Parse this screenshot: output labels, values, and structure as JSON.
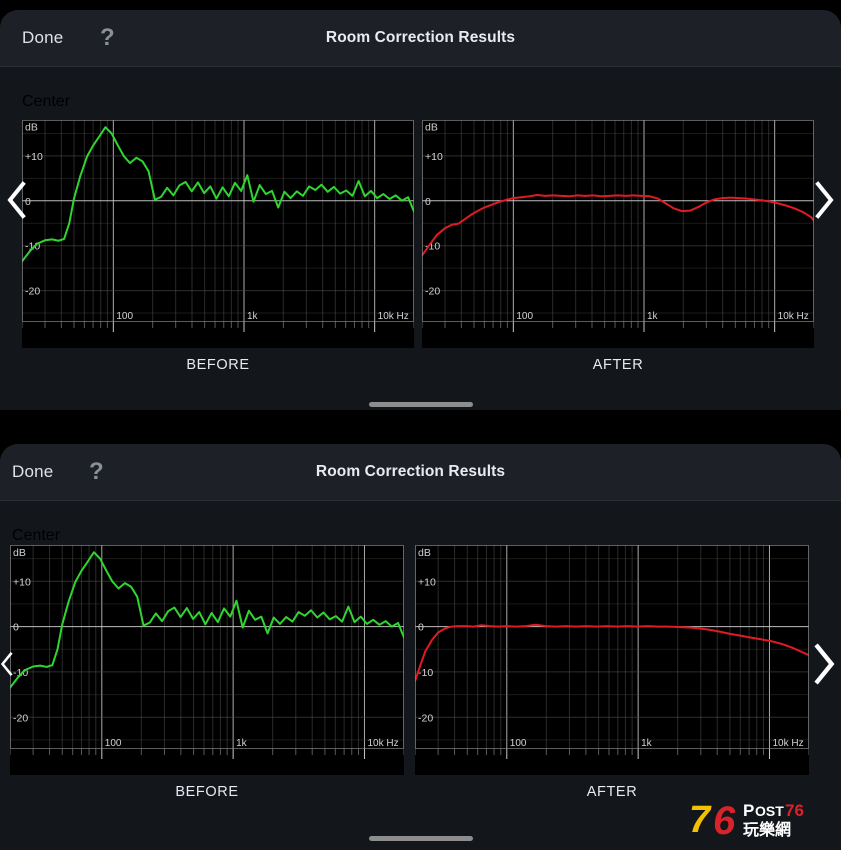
{
  "panels": [
    {
      "navbar": {
        "done_label": "Done",
        "help_icon": "question-mark-icon",
        "title": "Room Correction Results"
      },
      "channel": "Center",
      "before_caption": "BEFORE",
      "after_caption": "AFTER"
    },
    {
      "navbar": {
        "done_label": "Done",
        "help_icon": "question-mark-icon",
        "title": "Room Correction Results"
      },
      "channel": "Center",
      "before_caption": "BEFORE",
      "after_caption": "AFTER"
    }
  ],
  "nav": {
    "prev_icon": "chevron-left-icon",
    "next_icon": "chevron-right-icon"
  },
  "axis": {
    "y_unit": "dB",
    "y_ticks": [
      "+10",
      "0",
      "-10",
      "-20"
    ],
    "x_ticks": [
      "100",
      "1k",
      "10k Hz"
    ]
  },
  "colors": {
    "before_curve": "#2fd62f",
    "after_curve": "#e01b24",
    "plot_background": "#000000",
    "grid": "#4a4a4a",
    "zero_line": "#c8c8c8",
    "panel_background": "#13161b",
    "navbar_background": "#1d2026",
    "text": "#e9ecef"
  },
  "watermark": {
    "number": "76",
    "brand": "Post76",
    "chinese": "玩樂網"
  },
  "chart_data": [
    {
      "type": "line",
      "title": "Center BEFORE",
      "xlabel": "Hz",
      "ylabel": "dB",
      "xscale": "log",
      "xlim": [
        20,
        20000
      ],
      "ylim": [
        -27,
        18
      ],
      "grid": true,
      "series": [
        {
          "name": "BEFORE",
          "color": "#2fd62f",
          "x": [
            20,
            23,
            26,
            30,
            34,
            38,
            42,
            46,
            50,
            56,
            63,
            70,
            78,
            87,
            97,
            108,
            120,
            134,
            150,
            167,
            186,
            208,
            232,
            258,
            288,
            320,
            357,
            398,
            444,
            495,
            552,
            615,
            686,
            765,
            853,
            951,
            1060,
            1182,
            1318,
            1470,
            1639,
            1828,
            2038,
            2273,
            2535,
            2827,
            3152,
            3515,
            3920,
            4371,
            4874,
            5435,
            6061,
            6759,
            7537,
            8405,
            9373,
            10453,
            11657,
            13000,
            14497,
            16167,
            18030,
            20000
          ],
          "y": [
            -13.5,
            -11.2,
            -9.6,
            -8.8,
            -8.6,
            -8.9,
            -8.5,
            -5.0,
            0.5,
            5.6,
            9.9,
            12.3,
            14.3,
            16.4,
            15.0,
            12.4,
            10.0,
            8.4,
            9.6,
            8.8,
            6.6,
            0.2,
            0.9,
            2.9,
            1.2,
            3.4,
            4.2,
            2.1,
            4.1,
            1.7,
            3.2,
            0.5,
            3.0,
            1.0,
            4.0,
            2.2,
            5.7,
            -0.2,
            3.5,
            1.5,
            2.2,
            -1.5,
            2.0,
            0.6,
            2.1,
            1.1,
            3.2,
            2.4,
            3.6,
            2.0,
            3.1,
            1.6,
            2.3,
            1.1,
            4.4,
            1.0,
            2.2,
            0.6,
            1.5,
            0.4,
            1.2,
            0.0,
            0.8,
            -2.4
          ]
        }
      ]
    },
    {
      "type": "line",
      "title": "Center AFTER",
      "xlabel": "Hz",
      "ylabel": "dB",
      "xscale": "log",
      "xlim": [
        20,
        20000
      ],
      "ylim": [
        -27,
        18
      ],
      "grid": true,
      "series": [
        {
          "name": "AFTER",
          "color": "#e01b24",
          "x": [
            20,
            23,
            26,
            30,
            34,
            38,
            42,
            47,
            53,
            60,
            68,
            77,
            88,
            100,
            115,
            132,
            152,
            175,
            202,
            233,
            268,
            309,
            356,
            410,
            473,
            545,
            628,
            724,
            834,
            961,
            1108,
            1277,
            1471,
            1696,
            1954,
            2252,
            2595,
            2991,
            3447,
            3972,
            4578,
            5275,
            6079,
            7005,
            8073,
            9303,
            10721,
            12355,
            14237,
            16406,
            18904,
            20000
          ],
          "y": [
            -12.2,
            -9.7,
            -7.6,
            -6.1,
            -5.3,
            -5.1,
            -4.2,
            -3.2,
            -2.3,
            -1.5,
            -0.9,
            -0.3,
            0.2,
            0.6,
            0.8,
            1.0,
            1.3,
            1.1,
            1.2,
            1.1,
            1.0,
            1.2,
            1.1,
            1.2,
            1.0,
            1.1,
            1.2,
            1.1,
            1.2,
            1.1,
            1.0,
            0.5,
            -0.6,
            -1.7,
            -2.3,
            -2.2,
            -1.4,
            -0.4,
            0.3,
            0.6,
            0.7,
            0.6,
            0.5,
            0.3,
            0.1,
            -0.2,
            -0.6,
            -1.1,
            -1.7,
            -2.5,
            -3.6,
            -4.4
          ]
        }
      ]
    },
    {
      "type": "line",
      "title": "Center BEFORE (second view)",
      "xlabel": "Hz",
      "ylabel": "dB",
      "xscale": "log",
      "xlim": [
        20,
        20000
      ],
      "ylim": [
        -27,
        18
      ],
      "grid": true,
      "series": [
        {
          "name": "BEFORE",
          "color": "#2fd62f",
          "x": [
            20,
            23,
            26,
            30,
            34,
            38,
            42,
            46,
            50,
            56,
            63,
            70,
            78,
            87,
            97,
            108,
            120,
            134,
            150,
            167,
            186,
            208,
            232,
            258,
            288,
            320,
            357,
            398,
            444,
            495,
            552,
            615,
            686,
            765,
            853,
            951,
            1060,
            1182,
            1318,
            1470,
            1639,
            1828,
            2038,
            2273,
            2535,
            2827,
            3152,
            3515,
            3920,
            4371,
            4874,
            5435,
            6061,
            6759,
            7537,
            8405,
            9373,
            10453,
            11657,
            13000,
            14497,
            16167,
            18030,
            20000
          ],
          "y": [
            -13.5,
            -11.2,
            -9.6,
            -8.8,
            -8.6,
            -8.9,
            -8.5,
            -5.0,
            0.5,
            5.6,
            9.9,
            12.3,
            14.3,
            16.4,
            15.0,
            12.4,
            10.0,
            8.4,
            9.6,
            8.8,
            6.6,
            0.2,
            0.9,
            2.9,
            1.2,
            3.4,
            4.2,
            2.1,
            4.1,
            1.7,
            3.2,
            0.5,
            3.0,
            1.0,
            4.0,
            2.2,
            5.7,
            -0.2,
            3.5,
            1.5,
            2.2,
            -1.5,
            2.0,
            0.6,
            2.1,
            1.1,
            3.2,
            2.4,
            3.6,
            2.0,
            3.1,
            1.6,
            2.3,
            1.1,
            4.4,
            1.0,
            2.2,
            0.6,
            1.5,
            0.4,
            1.2,
            0.0,
            0.8,
            -2.4
          ]
        }
      ]
    },
    {
      "type": "line",
      "title": "Center AFTER (second view)",
      "xlabel": "Hz",
      "ylabel": "dB",
      "xscale": "log",
      "xlim": [
        20,
        20000
      ],
      "ylim": [
        -27,
        18
      ],
      "grid": true,
      "series": [
        {
          "name": "AFTER",
          "color": "#e01b24",
          "x": [
            20,
            22,
            24,
            27,
            30,
            34,
            38,
            43,
            49,
            56,
            64,
            74,
            86,
            100,
            118,
            140,
            166,
            198,
            236,
            282,
            337,
            403,
            482,
            577,
            690,
            826,
            989,
            1184,
            1418,
            1698,
            2033,
            2434,
            2915,
            3490,
            4179,
            5004,
            5991,
            7174,
            8590,
            10285,
            12314,
            14744,
            17653,
            20000
          ],
          "y": [
            -12.0,
            -8.5,
            -5.4,
            -2.9,
            -1.3,
            -0.4,
            0.0,
            0.1,
            0.1,
            0.0,
            0.3,
            0.1,
            0.0,
            0.1,
            0.0,
            0.1,
            0.4,
            0.1,
            0.0,
            0.1,
            0.0,
            0.1,
            0.0,
            0.1,
            0.0,
            0.1,
            0.0,
            0.1,
            0.0,
            0.0,
            -0.1,
            -0.2,
            -0.4,
            -0.7,
            -1.1,
            -1.6,
            -2.0,
            -2.4,
            -2.8,
            -3.2,
            -3.8,
            -4.6,
            -5.6,
            -6.3
          ]
        }
      ]
    }
  ]
}
